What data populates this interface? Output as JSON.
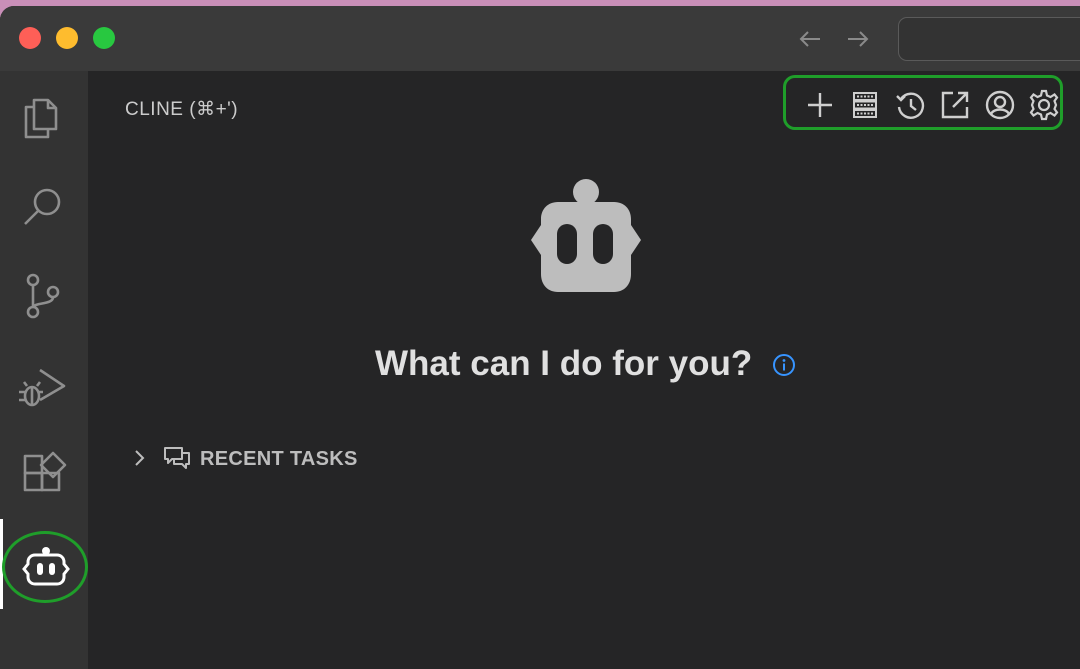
{
  "panel": {
    "title": "CLINE (⌘+')"
  },
  "toolbar": {
    "buttons": [
      "plus-icon",
      "server-icon",
      "history-icon",
      "popout-icon",
      "account-icon",
      "gear-icon"
    ]
  },
  "welcome": {
    "headline": "What can I do for you?"
  },
  "recent_tasks": {
    "label": "RECENT TASKS"
  },
  "activity_bar": {
    "items": [
      "explorer-icon",
      "search-icon",
      "source-control-icon",
      "run-debug-icon",
      "extensions-icon",
      "cline-icon"
    ]
  },
  "colors": {
    "highlight": "#1f9e2a",
    "info": "#3794ff"
  }
}
